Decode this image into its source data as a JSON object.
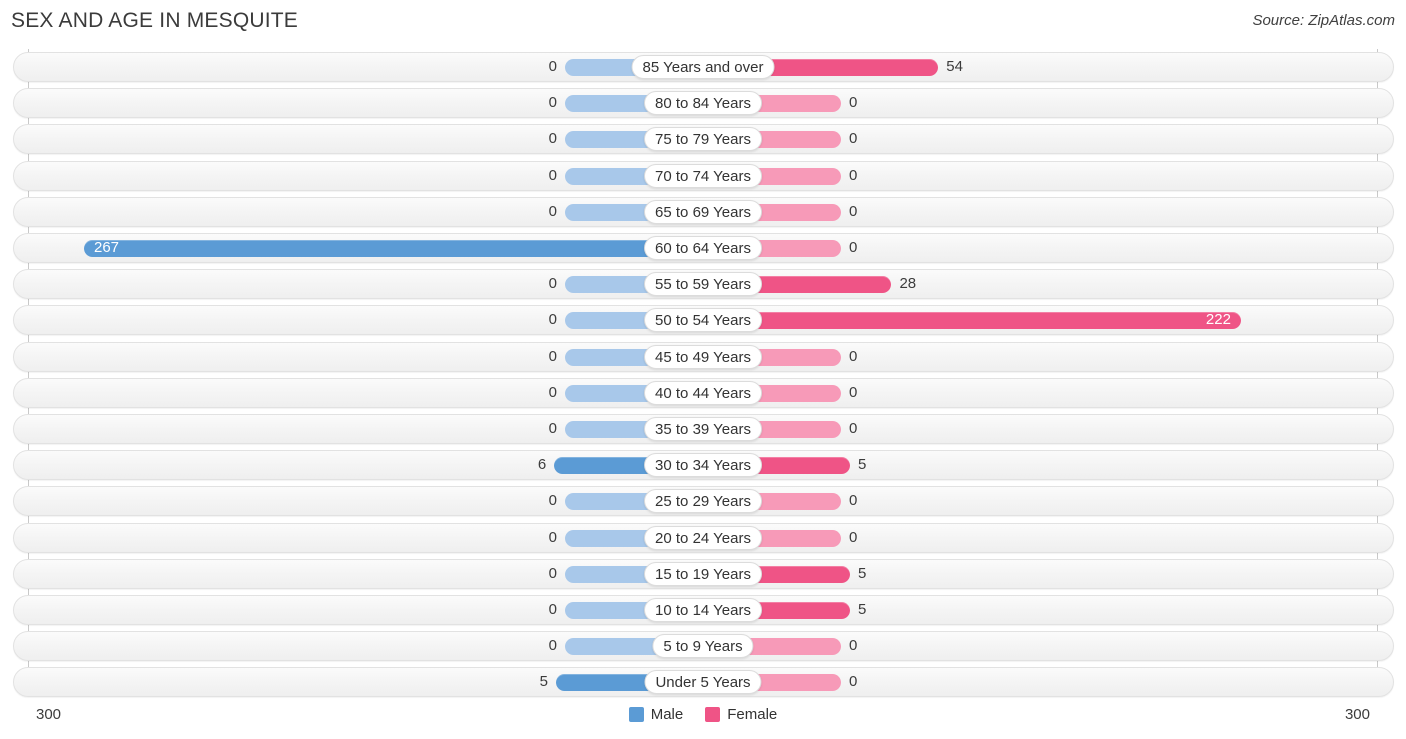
{
  "header": {
    "title": "SEX AND AGE IN MESQUITE",
    "source": "Source: ZipAtlas.com"
  },
  "legend": {
    "male_label": "Male",
    "female_label": "Female",
    "male_color": "#5b9bd5",
    "female_color": "#ef5486"
  },
  "axis": {
    "left_max": "300",
    "right_max": "300"
  },
  "chart_data": {
    "type": "bar",
    "subtype": "population-pyramid",
    "title": "SEX AND AGE IN MESQUITE",
    "xlabel": "",
    "ylabel": "",
    "xlim": [
      300,
      300
    ],
    "axis_max": 300,
    "grid": false,
    "legend_position": "bottom-center",
    "categories": [
      "85 Years and over",
      "80 to 84 Years",
      "75 to 79 Years",
      "70 to 74 Years",
      "65 to 69 Years",
      "60 to 64 Years",
      "55 to 59 Years",
      "50 to 54 Years",
      "45 to 49 Years",
      "40 to 44 Years",
      "35 to 39 Years",
      "30 to 34 Years",
      "25 to 29 Years",
      "20 to 24 Years",
      "15 to 19 Years",
      "10 to 14 Years",
      "5 to 9 Years",
      "Under 5 Years"
    ],
    "series": [
      {
        "name": "Male",
        "color": "#5b9bd5",
        "values": [
          0,
          0,
          0,
          0,
          0,
          267,
          0,
          0,
          0,
          0,
          0,
          6,
          0,
          0,
          0,
          0,
          0,
          5
        ]
      },
      {
        "name": "Female",
        "color": "#ef5486",
        "values": [
          54,
          0,
          0,
          0,
          0,
          0,
          28,
          222,
          0,
          0,
          0,
          5,
          0,
          0,
          5,
          5,
          0,
          0
        ]
      }
    ]
  },
  "rows": [
    {
      "label": "85 Years and over",
      "male": "0",
      "female": "54"
    },
    {
      "label": "80 to 84 Years",
      "male": "0",
      "female": "0"
    },
    {
      "label": "75 to 79 Years",
      "male": "0",
      "female": "0"
    },
    {
      "label": "70 to 74 Years",
      "male": "0",
      "female": "0"
    },
    {
      "label": "65 to 69 Years",
      "male": "0",
      "female": "0"
    },
    {
      "label": "60 to 64 Years",
      "male": "267",
      "female": "0"
    },
    {
      "label": "55 to 59 Years",
      "male": "0",
      "female": "28"
    },
    {
      "label": "50 to 54 Years",
      "male": "0",
      "female": "222"
    },
    {
      "label": "45 to 49 Years",
      "male": "0",
      "female": "0"
    },
    {
      "label": "40 to 44 Years",
      "male": "0",
      "female": "0"
    },
    {
      "label": "35 to 39 Years",
      "male": "0",
      "female": "0"
    },
    {
      "label": "30 to 34 Years",
      "male": "6",
      "female": "5"
    },
    {
      "label": "25 to 29 Years",
      "male": "0",
      "female": "0"
    },
    {
      "label": "20 to 24 Years",
      "male": "0",
      "female": "0"
    },
    {
      "label": "15 to 19 Years",
      "male": "0",
      "female": "5"
    },
    {
      "label": "10 to 14 Years",
      "male": "0",
      "female": "5"
    },
    {
      "label": "5 to 9 Years",
      "male": "0",
      "female": "0"
    },
    {
      "label": "Under 5 Years",
      "male": "5",
      "female": "0"
    }
  ]
}
